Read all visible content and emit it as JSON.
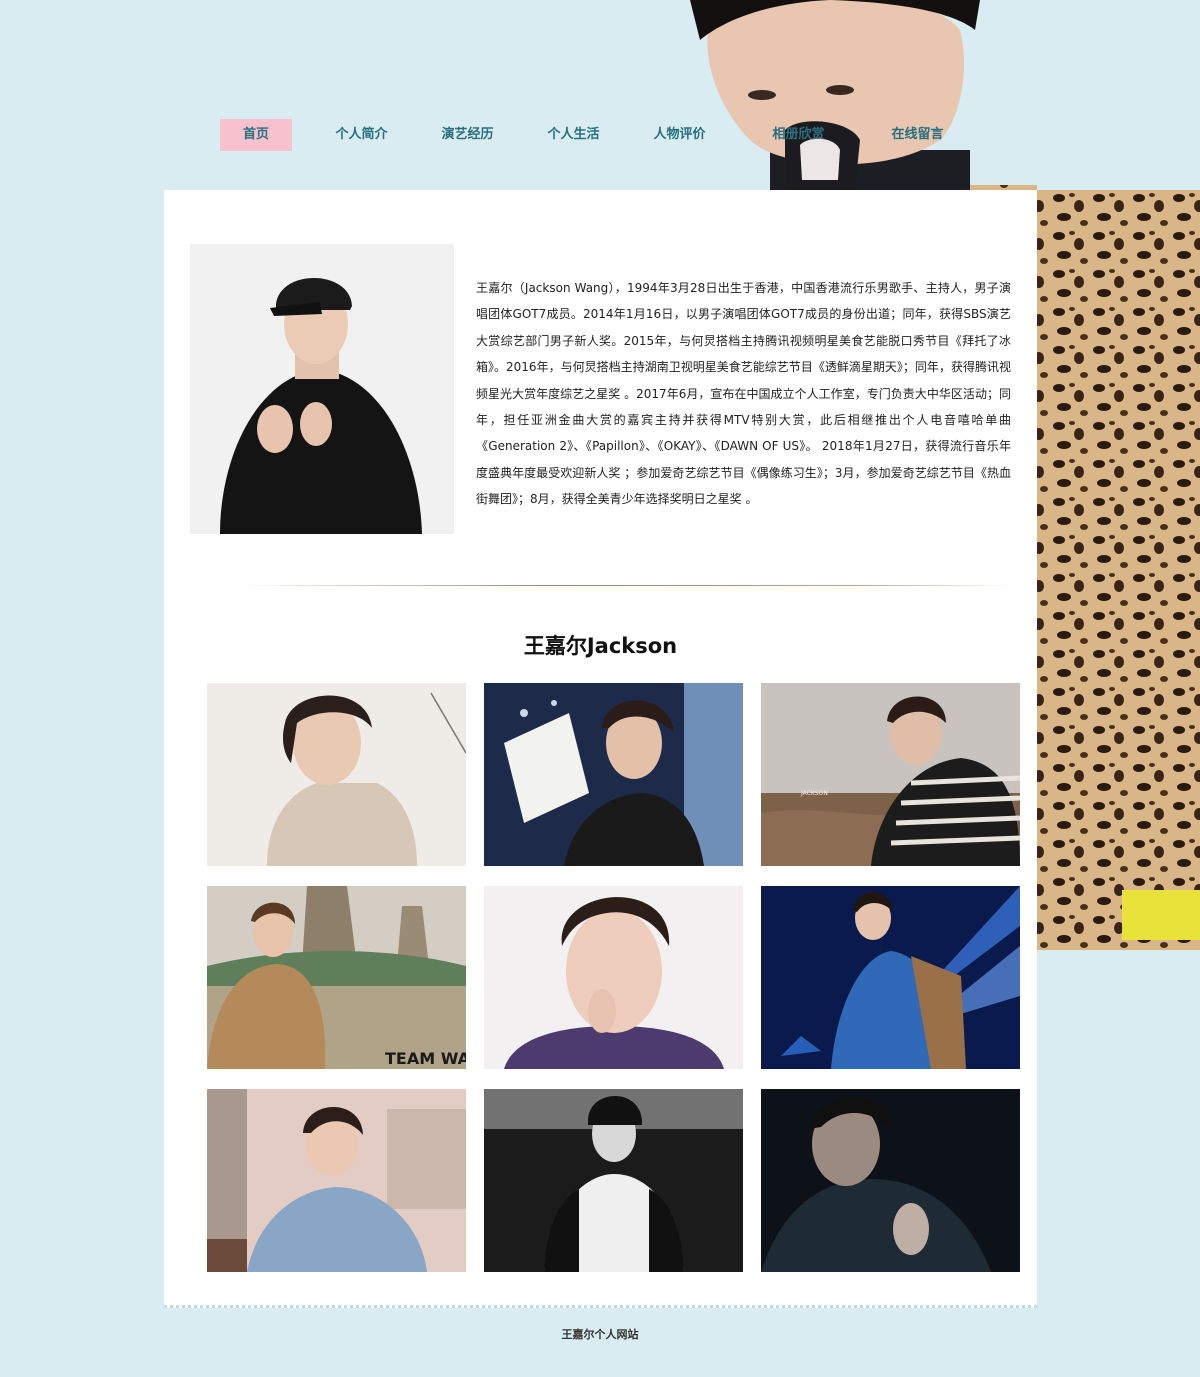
{
  "nav": {
    "items": [
      {
        "label": "首页",
        "active": true
      },
      {
        "label": "个人简介",
        "active": false
      },
      {
        "label": "演艺经历",
        "active": false
      },
      {
        "label": "个人生活",
        "active": false
      },
      {
        "label": "人物评价",
        "active": false
      },
      {
        "label": "相册欣赏",
        "active": false
      },
      {
        "label": "在线留言",
        "active": false
      }
    ]
  },
  "intro": {
    "text": "王嘉尔（Jackson Wang），1994年3月28日出生于香港，中国香港流行乐男歌手、主持人，男子演唱团体GOT7成员。2014年1月16日，以男子演唱团体GOT7成员的身份出道；同年，获得SBS演艺大赏综艺部门男子新人奖。2015年，与何炅搭档主持腾讯视频明星美食艺能脱口秀节目《拜托了冰箱》。2016年，与何炅搭档主持湖南卫视明星美食艺能综艺节目《透鲜滴星期天》；同年，获得腾讯视频星光大赏年度综艺之星奖 。2017年6月，宣布在中国成立个人工作室，专门负责大中华区活动；同年，担任亚洲金曲大赏的嘉宾主持并获得MTV特别大赏，此后相继推出个人电音嘻哈单曲《Generation 2》、《Papillon》、《OKAY》、《DAWN OF US》。 2018年1月27日，获得流行音乐年度盛典年度最受欢迎新人奖 ；参加爱奇艺综艺节目《偶像练习生》；3月，参加爱奇艺综艺节目《热血街舞团》；8月，获得全美青少年选择奖明日之星奖 。"
  },
  "gallery": {
    "title": "王嘉尔Jackson",
    "photos": [
      {
        "caption": ""
      },
      {
        "caption": ""
      },
      {
        "caption": "JACKSON"
      },
      {
        "caption": "TEAM WANG"
      },
      {
        "caption": ""
      },
      {
        "caption": ""
      },
      {
        "caption": ""
      },
      {
        "caption": ""
      },
      {
        "caption": ""
      }
    ]
  },
  "footer": {
    "text": "王嘉尔个人网站"
  }
}
